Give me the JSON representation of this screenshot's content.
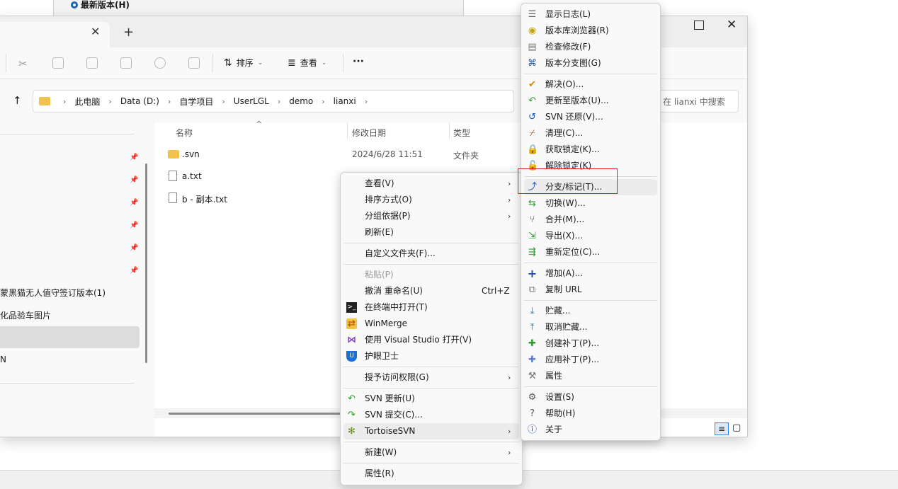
{
  "background_dialog": {
    "radio_label": "最新版本(H)"
  },
  "explorer": {
    "tab": {
      "close_glyph": "✕",
      "add_glyph": "+"
    },
    "window_controls": {
      "close_glyph": "✕"
    },
    "toolbar": {
      "sort_label": "排序",
      "view_label": "查看",
      "more_label": "···"
    },
    "address": {
      "segments": [
        "此电脑",
        "Data (D:)",
        "自学项目",
        "UserLGL",
        "demo",
        "lianxi"
      ]
    },
    "search_placeholder": "在 lianxi 中搜索",
    "nav_items": [
      "蒙黑猫无人值守签订版本(1)",
      "化品验车图片",
      "N"
    ],
    "columns": {
      "name": "名称",
      "modified": "修改日期",
      "type": "类型"
    },
    "files": [
      {
        "name": ".svn",
        "modified": "2024/6/28 11:51",
        "type": "文件夹",
        "kind": "folder"
      },
      {
        "name": "a.txt",
        "modified": "",
        "type": "",
        "kind": "file"
      },
      {
        "name": "b - 副本.txt",
        "modified": "",
        "type": "",
        "kind": "file"
      }
    ]
  },
  "context_menu": {
    "items": [
      {
        "label": "查看(V)",
        "submenu": true
      },
      {
        "label": "排序方式(O)",
        "submenu": true
      },
      {
        "label": "分组依据(P)",
        "submenu": true
      },
      {
        "label": "刷新(E)"
      },
      {
        "label": "自定义文件夹(F)..."
      },
      {
        "label": "粘贴(P)",
        "disabled": true
      },
      {
        "label": "撤消 重命名(U)",
        "shortcut": "Ctrl+Z"
      },
      {
        "label": "在终端中打开(T)",
        "icon": "terminal-icon"
      },
      {
        "label": "WinMerge",
        "icon": "winmerge-icon"
      },
      {
        "label": "使用 Visual Studio 打开(V)",
        "icon": "visual-studio-icon"
      },
      {
        "label": "护眼卫士",
        "icon": "shield-icon"
      },
      {
        "label": "授予访问权限(G)",
        "submenu": true
      },
      {
        "label": "SVN 更新(U)",
        "icon": "svn-update-icon"
      },
      {
        "label": "SVN 提交(C)...",
        "icon": "svn-commit-icon"
      },
      {
        "label": "TortoiseSVN",
        "icon": "tortoisesvn-icon",
        "submenu": true,
        "hover": true
      },
      {
        "label": "新建(W)",
        "submenu": true
      },
      {
        "label": "属性(R)"
      }
    ],
    "submenu_glyph": "›"
  },
  "tortoise_menu": {
    "items": [
      {
        "label": "显示日志(L)",
        "icon": "log-icon"
      },
      {
        "label": "版本库浏览器(R)",
        "icon": "repo-browser-icon"
      },
      {
        "label": "检查修改(F)",
        "icon": "check-modifications-icon"
      },
      {
        "label": "版本分支图(G)",
        "icon": "revision-graph-icon"
      },
      {
        "label": "解决(O)...",
        "icon": "resolve-icon"
      },
      {
        "label": "更新至版本(U)...",
        "icon": "update-to-revision-icon"
      },
      {
        "label": "SVN 还原(V)...",
        "icon": "revert-icon"
      },
      {
        "label": "清理(C)...",
        "icon": "cleanup-icon"
      },
      {
        "label": "获取锁定(K)...",
        "icon": "lock-icon"
      },
      {
        "label": "解除锁定(K)",
        "icon": "unlock-icon"
      },
      {
        "label": "分支/标记(T)...",
        "icon": "branch-tag-icon",
        "hover": true
      },
      {
        "label": "切换(W)...",
        "icon": "switch-icon"
      },
      {
        "label": "合并(M)...",
        "icon": "merge-icon"
      },
      {
        "label": "导出(X)...",
        "icon": "export-icon"
      },
      {
        "label": "重新定位(C)...",
        "icon": "relocate-icon"
      },
      {
        "label": "增加(A)...",
        "icon": "add-icon"
      },
      {
        "label": "复制 URL",
        "icon": "copy-url-icon"
      },
      {
        "label": "贮藏...",
        "icon": "shelve-icon"
      },
      {
        "label": "取消贮藏...",
        "icon": "unshelve-icon"
      },
      {
        "label": "创建补丁(P)...",
        "icon": "create-patch-icon"
      },
      {
        "label": "应用补丁(P)...",
        "icon": "apply-patch-icon"
      },
      {
        "label": "属性",
        "icon": "properties-icon"
      },
      {
        "label": "设置(S)",
        "icon": "settings-icon"
      },
      {
        "label": "帮助(H)",
        "icon": "help-icon"
      },
      {
        "label": "关于",
        "icon": "about-icon"
      }
    ]
  },
  "colors": {
    "highlight_box": "#e02020",
    "accent": "#3584e4",
    "folder": "#f2c24c"
  }
}
